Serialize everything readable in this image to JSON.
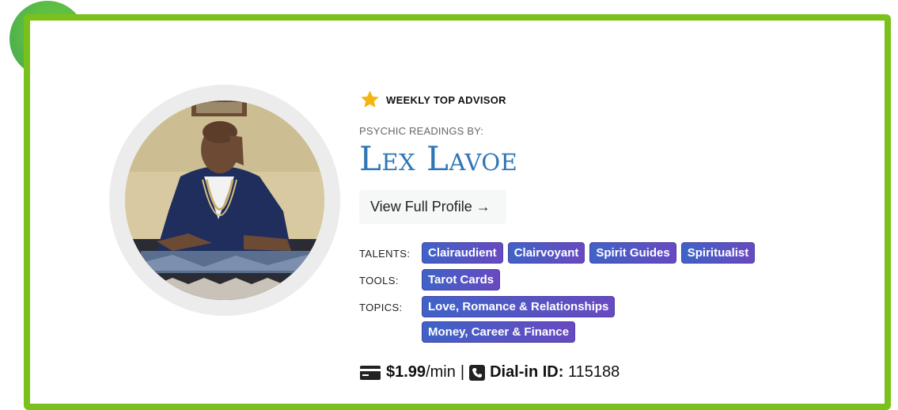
{
  "badge": {
    "label": "WEEKLY TOP ADVISOR",
    "icon": "star-icon"
  },
  "subtitle": "PSYCHIC READINGS BY:",
  "advisor_name": "Lex Lavoe",
  "profile_button": "View Full Profile →",
  "talents": {
    "label": "TALENTS:",
    "items": [
      "Clairaudient",
      "Clairvoyant",
      "Spirit Guides",
      "Spiritualist"
    ]
  },
  "tools": {
    "label": "TOOLS:",
    "items": [
      "Tarot Cards"
    ]
  },
  "topics": {
    "label": "TOPICS:",
    "items": [
      "Love, Romance & Relationships",
      "Money, Career & Finance"
    ]
  },
  "pricing": {
    "price": "$1.99",
    "unit": "/min",
    "separator": "|",
    "dial_label": "Dial-in ID:",
    "dial_id": "115188"
  },
  "colors": {
    "frame_green": "#7ac21b",
    "name_blue": "#2e76b5",
    "chip_start": "#3e63c7",
    "chip_end": "#6949c1",
    "star": "#f6b40e"
  }
}
